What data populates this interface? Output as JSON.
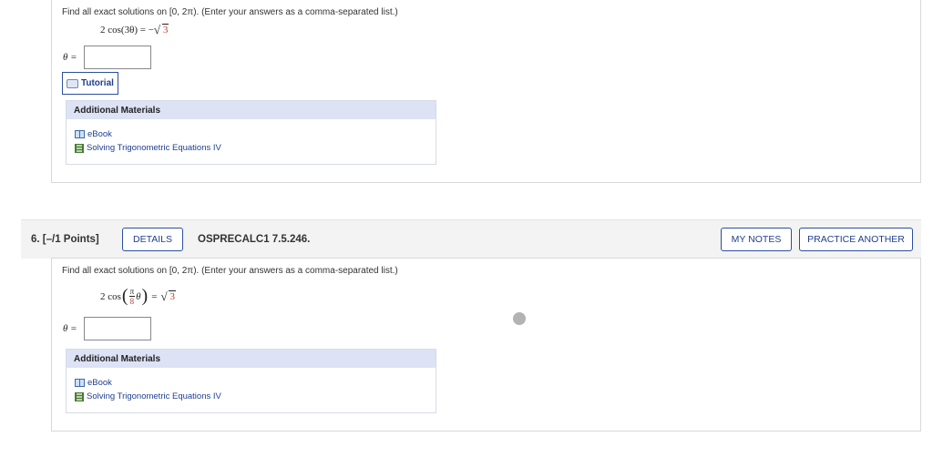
{
  "q5": {
    "prompt": "Find all exact solutions on [0, 2π). (Enter your answers as a comma-separated list.)",
    "equation_lhs": "2 cos(3θ) = −",
    "equation_rad": "3",
    "theta_label": "θ =",
    "answer_value": "",
    "tutorial_label": "Tutorial",
    "additional_materials": {
      "header": "Additional Materials",
      "ebook": "eBook",
      "video": "Solving Trigonometric Equations IV"
    }
  },
  "q6": {
    "number": "6.  [–/1 Points]",
    "details_label": "DETAILS",
    "code": "OSPRECALC1 7.5.246.",
    "my_notes_label": "MY NOTES",
    "practice_label": "PRACTICE ANOTHER",
    "prompt": "Find all exact solutions on [0, 2π). (Enter your answers as a comma-separated list.)",
    "eq_coef": "2 cos",
    "eq_num": "π",
    "eq_theta": "θ",
    "eq_den": "8",
    "eq_equals": "=",
    "eq_rad": "3",
    "theta_label": "θ =",
    "answer_value": "",
    "additional_materials": {
      "header": "Additional Materials",
      "ebook": "eBook",
      "video": "Solving Trigonometric Equations IV"
    }
  },
  "colors": {
    "accent": "#2b4f9e",
    "answer_red": "#c0392b",
    "materials_header": "#dde3f5"
  }
}
